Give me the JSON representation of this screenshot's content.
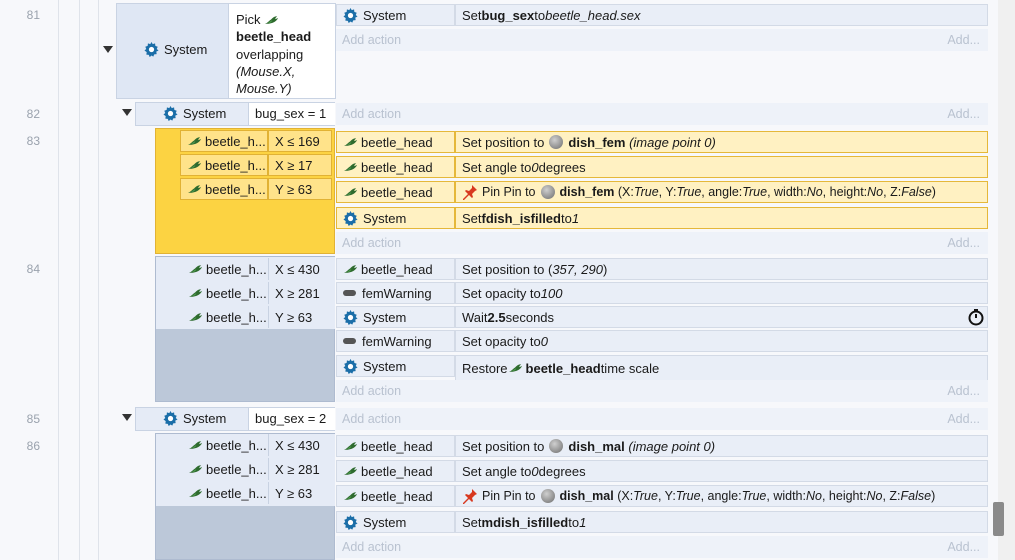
{
  "rows": [
    {
      "num": "81"
    },
    {
      "num": "82"
    },
    {
      "num": "83"
    },
    {
      "num": "84"
    },
    {
      "num": "85"
    },
    {
      "num": "86"
    }
  ],
  "e81": {
    "system_label": "System",
    "pick_1": "Pick",
    "pick_obj": "beetle_head",
    "pick_2": "overlapping",
    "pick_3": "(Mouse.X,",
    "pick_4": "Mouse.Y)",
    "a1_obj": "System",
    "a1_pre": "Set ",
    "a1_var": "bug_sex",
    "a1_mid": " to ",
    "a1_val": "beetle_head.sex"
  },
  "e82": {
    "system_label": "System",
    "cond": "bug_sex = 1"
  },
  "e83": {
    "conds": [
      {
        "obj": "beetle_h...",
        "cmp": "X ≤ 169"
      },
      {
        "obj": "beetle_h...",
        "cmp": "X ≥ 17"
      },
      {
        "obj": "beetle_h...",
        "cmp": "Y ≥ 63"
      }
    ],
    "a1_obj": "beetle_head",
    "a1_pre": "Set position to ",
    "a1_target": "dish_fem",
    "a1_post": "(image point 0)",
    "a2_obj": "beetle_head",
    "a2_pre": "Set angle to ",
    "a2_val": "0",
    "a2_post": " degrees",
    "a3_obj": "beetle_head",
    "a3_pre": "Pin Pin to ",
    "a3_target": "dish_fem",
    "a3_post": "(X: ",
    "a3_x": "True",
    "a3_y_lbl": ", Y: ",
    "a3_y": "True",
    "a3_ang_lbl": ", angle: ",
    "a3_ang": "True",
    "a3_w_lbl": ", width: ",
    "a3_w": "No",
    "a3_h_lbl": ", height: ",
    "a3_h": "No",
    "a3_z_lbl": ", Z: ",
    "a3_z": "False",
    "a3_end": ")",
    "a4_obj": "System",
    "a4_pre": "Set ",
    "a4_var": "fdish_isfilled",
    "a4_mid": " to ",
    "a4_val": "1"
  },
  "e84": {
    "conds": [
      {
        "obj": "beetle_h...",
        "cmp": "X ≤ 430"
      },
      {
        "obj": "beetle_h...",
        "cmp": "X ≥ 281"
      },
      {
        "obj": "beetle_h...",
        "cmp": "Y ≥ 63"
      }
    ],
    "a1_obj": "beetle_head",
    "a1_pre": "Set position to (",
    "a1_val": "357, 290",
    "a1_end": ")",
    "a2_obj": "femWarning",
    "a2_pre": "Set opacity to ",
    "a2_val": "100",
    "a3_obj": "System",
    "a3_pre": "Wait ",
    "a3_val": "2.5",
    "a3_post": " seconds",
    "a4_obj": "femWarning",
    "a4_pre": "Set opacity to ",
    "a4_val": "0",
    "a5_obj": "System",
    "a5_pre": "Restore ",
    "a5_target": "beetle_head",
    "a5_post": " time scale"
  },
  "e85": {
    "system_label": "System",
    "cond": "bug_sex = 2"
  },
  "e86": {
    "conds": [
      {
        "obj": "beetle_h...",
        "cmp": "X ≤ 430"
      },
      {
        "obj": "beetle_h...",
        "cmp": "X ≥ 281"
      },
      {
        "obj": "beetle_h...",
        "cmp": "Y ≥ 63"
      }
    ],
    "a1_obj": "beetle_head",
    "a1_pre": "Set position to ",
    "a1_target": "dish_mal",
    "a1_post": "(image point 0)",
    "a2_obj": "beetle_head",
    "a2_pre": "Set angle to ",
    "a2_val": "0",
    "a2_post": " degrees",
    "a3_obj": "beetle_head",
    "a3_pre": "Pin Pin to ",
    "a3_target": "dish_mal",
    "a3_post": "(X: ",
    "a3_x": "True",
    "a3_y_lbl": ", Y: ",
    "a3_y": "True",
    "a3_ang_lbl": ", angle: ",
    "a3_ang": "True",
    "a3_w_lbl": ", width: ",
    "a3_w": "No",
    "a3_h_lbl": ", height: ",
    "a3_h": "No",
    "a3_z_lbl": ", Z: ",
    "a3_z": "False",
    "a3_end": ")",
    "a4_obj": "System",
    "a4_pre": "Set ",
    "a4_var": "mdish_isfilled",
    "a4_mid": " to ",
    "a4_val": "1"
  },
  "ui": {
    "add_action": "Add action",
    "add": "Add..."
  },
  "colors": {
    "highlight": "#ffe38a",
    "highlight_border": "#e1b234",
    "block": "#e5ebf6",
    "accent_gear": "#1b6ea8"
  },
  "icons": {
    "gear": "gear-icon",
    "beetle": "beetle-sprite-icon",
    "pin": "pin-icon",
    "sprite": "sprite-ball-icon",
    "timer": "stopwatch-icon",
    "pill": "text-object-icon"
  }
}
